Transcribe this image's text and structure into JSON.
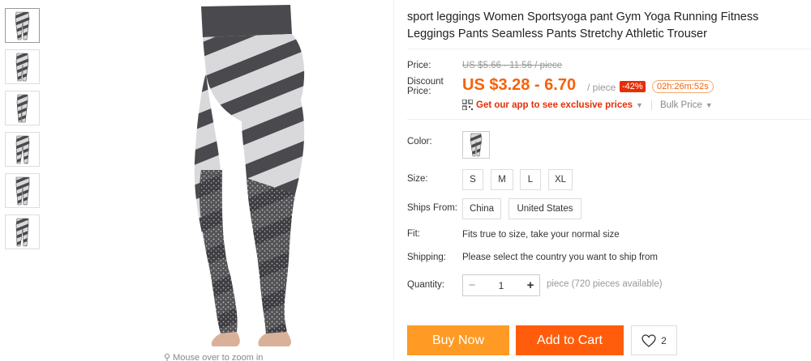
{
  "gallery": {
    "thumbnail_icons": [
      "leggings-thumb-1",
      "leggings-thumb-2",
      "leggings-thumb-3",
      "leggings-thumb-4",
      "leggings-thumb-5",
      "leggings-thumb-6"
    ],
    "zoom_hint": "Mouse over to zoom in"
  },
  "product": {
    "title": "sport leggings Women Sportsyoga pant Gym Yoga Running Fitness Leggings Pants Seamless Pants Stretchy Athletic Trouser"
  },
  "pricing": {
    "price_label": "Price:",
    "original_price": "US $5.66 - 11.56 / piece",
    "discount_label_line1": "Discount",
    "discount_label_line2": "Price:",
    "discount_price": "US $3.28 - 6.70",
    "per_piece": "/ piece",
    "discount_badge": "-42%",
    "countdown": "02h:26m:52s",
    "app_promo": "Get our app to see exclusive prices",
    "bulk_price": "Bulk Price",
    "accent_color": "#f5620a"
  },
  "options": {
    "color_label": "Color:",
    "size_label": "Size:",
    "sizes": [
      "S",
      "M",
      "L",
      "XL"
    ],
    "ships_from_label": "Ships From:",
    "ships_from": [
      "China",
      "United States"
    ],
    "fit_label": "Fit:",
    "fit_text": "Fits true to size, take your normal size",
    "shipping_label": "Shipping:",
    "shipping_text": "Please select the country you want to ship from",
    "quantity_label": "Quantity:",
    "quantity_value": "1",
    "quantity_note": "piece (720 pieces available)"
  },
  "actions": {
    "buy_now": "Buy Now",
    "add_to_cart": "Add to Cart",
    "wishlist_count": "2"
  }
}
